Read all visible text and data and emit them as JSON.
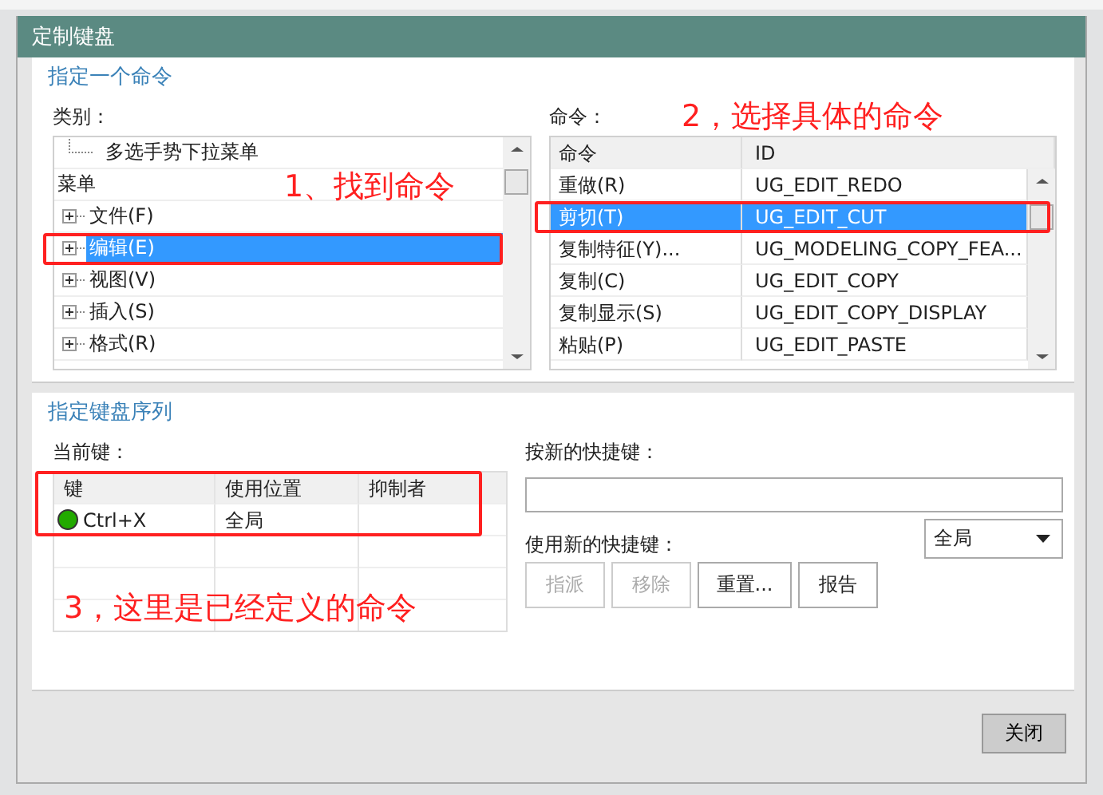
{
  "window": {
    "title": "定制键盘"
  },
  "command_section": {
    "heading": "指定一个命令",
    "category_label": "类别：",
    "categories": [
      {
        "label": "多选手势下拉菜单",
        "kind": "leaf",
        "selected": false
      },
      {
        "label": "菜单",
        "kind": "branch",
        "expanded": true,
        "selected": false,
        "children": [
          {
            "label": "文件(F)",
            "kind": "branch",
            "expanded": false,
            "selected": false
          },
          {
            "label": "编辑(E)",
            "kind": "branch",
            "expanded": false,
            "selected": true
          },
          {
            "label": "视图(V)",
            "kind": "branch",
            "expanded": false,
            "selected": false
          },
          {
            "label": "插入(S)",
            "kind": "branch",
            "expanded": false,
            "selected": false
          },
          {
            "label": "格式(R)",
            "kind": "branch",
            "expanded": false,
            "selected": false
          }
        ]
      }
    ],
    "command_label": "命令：",
    "command_columns": [
      "命令",
      "ID"
    ],
    "commands": [
      {
        "name": "重做(R)",
        "id": "UG_EDIT_REDO",
        "selected": false
      },
      {
        "name": "剪切(T)",
        "id": "UG_EDIT_CUT",
        "selected": true
      },
      {
        "name": "复制特征(Y)...",
        "id": "UG_MODELING_COPY_FEA...",
        "selected": false
      },
      {
        "name": "复制(C)",
        "id": "UG_EDIT_COPY",
        "selected": false
      },
      {
        "name": "复制显示(S)",
        "id": "UG_EDIT_COPY_DISPLAY",
        "selected": false
      },
      {
        "name": "粘贴(P)",
        "id": "UG_EDIT_PASTE",
        "selected": false
      }
    ]
  },
  "key_section": {
    "heading": "指定键盘序列",
    "current_keys_label": "当前键：",
    "key_columns": [
      "键",
      "使用位置",
      "抑制者"
    ],
    "keys": [
      {
        "key": "Ctrl+X",
        "location": "全局",
        "color": "#22aa00"
      }
    ],
    "new_key_label": "按新的快捷键：",
    "use_label": "使用新的快捷键：",
    "scope": "全局",
    "buttons": [
      {
        "label": "指派",
        "disabled": true
      },
      {
        "label": "移除",
        "disabled": true
      },
      {
        "label": "重置...",
        "disabled": false
      },
      {
        "label": "报告",
        "disabled": false
      }
    ]
  },
  "close_button": "关闭",
  "annotations": [
    {
      "text": "1、找到命令"
    },
    {
      "text": "2，选择具体的命令"
    },
    {
      "text": "3，这里是已经定义的命令"
    }
  ]
}
